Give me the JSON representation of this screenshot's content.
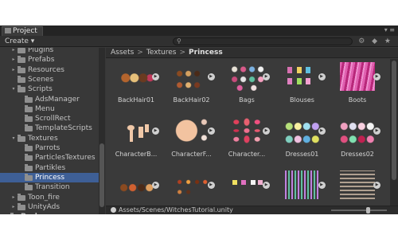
{
  "tab": {
    "title": "Project",
    "controls": "▾ ≡"
  },
  "toolbar": {
    "create_label": "Create ▾",
    "search_placeholder": "",
    "tool_icons": "⚙ ◆ ★"
  },
  "tree": {
    "items": [
      {
        "label": "Plugins",
        "indent": 2,
        "arrow": "▸"
      },
      {
        "label": "Prefabs",
        "indent": 2,
        "arrow": "▸"
      },
      {
        "label": "Resources",
        "indent": 2,
        "arrow": "▸"
      },
      {
        "label": "Scenes",
        "indent": 2,
        "arrow": ""
      },
      {
        "label": "Scripts",
        "indent": 2,
        "arrow": "▾"
      },
      {
        "label": "AdsManager",
        "indent": 3,
        "arrow": ""
      },
      {
        "label": "Menu",
        "indent": 3,
        "arrow": ""
      },
      {
        "label": "ScrollRect",
        "indent": 3,
        "arrow": ""
      },
      {
        "label": "TemplateScripts",
        "indent": 3,
        "arrow": ""
      },
      {
        "label": "Textures",
        "indent": 2,
        "arrow": "▾"
      },
      {
        "label": "Parrots",
        "indent": 3,
        "arrow": ""
      },
      {
        "label": "ParticlesTextures",
        "indent": 3,
        "arrow": ""
      },
      {
        "label": "Partikles",
        "indent": 3,
        "arrow": ""
      },
      {
        "label": "Princess",
        "indent": 3,
        "arrow": "",
        "selected": true
      },
      {
        "label": "Transition",
        "indent": 3,
        "arrow": ""
      },
      {
        "label": "Toon_fire",
        "indent": 2,
        "arrow": "▸"
      },
      {
        "label": "UnityAds",
        "indent": 2,
        "arrow": "▸"
      },
      {
        "label": "Packages",
        "indent": 1,
        "arrow": "▸"
      }
    ]
  },
  "breadcrumb": {
    "part1": "Assets",
    "part2": "Textures",
    "current": "Princess",
    "sep": ">"
  },
  "assets": [
    {
      "name": "BackHair01",
      "thumb": "pat-hair"
    },
    {
      "name": "BackHair02",
      "thumb": "pat-hair2"
    },
    {
      "name": "Bags",
      "thumb": "pat-bags"
    },
    {
      "name": "Blouses",
      "thumb": "pat-blouses"
    },
    {
      "name": "Boots",
      "thumb": "pat-boots"
    },
    {
      "name": "CharacterB...",
      "thumb": "pat-body"
    },
    {
      "name": "CharacterF...",
      "thumb": "pat-face"
    },
    {
      "name": "Character...",
      "thumb": "pat-lips"
    },
    {
      "name": "Dresses01",
      "thumb": "pat-dress1"
    },
    {
      "name": "Dresses02",
      "thumb": "pat-dress2"
    },
    {
      "name": "",
      "thumb": "pat-row3a"
    },
    {
      "name": "",
      "thumb": "pat-row3b"
    },
    {
      "name": "",
      "thumb": "pat-row3c"
    },
    {
      "name": "",
      "thumb": "pat-row3d"
    },
    {
      "name": "",
      "thumb": "pat-row3e"
    }
  ],
  "statusbar": {
    "path": "Assets/Scenes/WitchesTutorial.unity"
  },
  "icons": {
    "play": "▶",
    "search": "⚲"
  },
  "colors": {
    "selection": "#3e5f96",
    "background": "#383838"
  }
}
